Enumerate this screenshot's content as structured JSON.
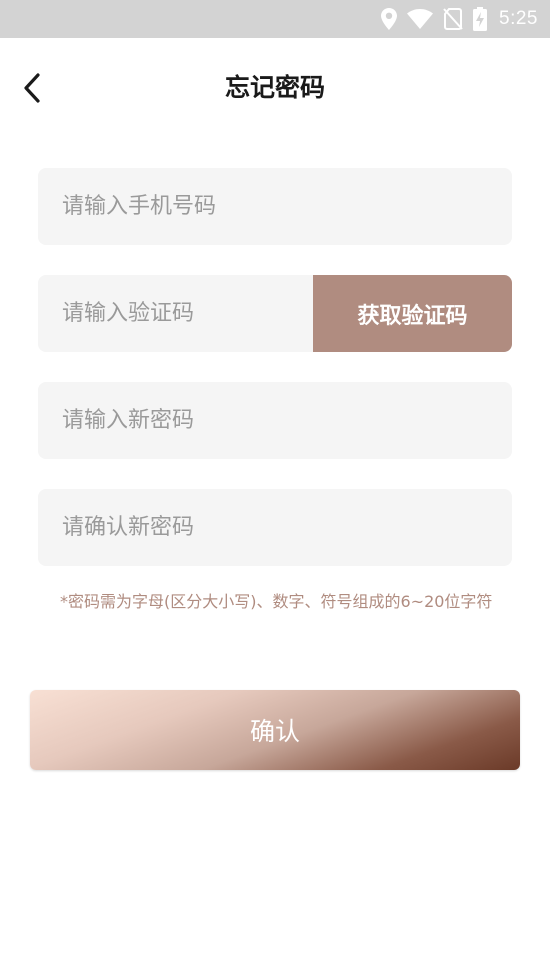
{
  "status_bar": {
    "time": "5:25",
    "icons": [
      "location-icon",
      "wifi-icon",
      "no-sim-icon",
      "battery-charging-icon"
    ]
  },
  "header": {
    "title": "忘记密码",
    "back_icon": "chevron-left-icon"
  },
  "form": {
    "phone_placeholder": "请输入手机号码",
    "code_placeholder": "请输入验证码",
    "get_code_label": "获取验证码",
    "new_password_placeholder": "请输入新密码",
    "confirm_password_placeholder": "请确认新密码",
    "hint": "*密码需为字母(区分大小写)、数字、符号组成的6~20位字符",
    "submit_label": "确认"
  },
  "colors": {
    "accent": "#b08c80",
    "field_bg": "#f5f5f5",
    "status_bar_bg": "#d3d3d3",
    "gradient_start": "#f8e0d4",
    "gradient_end": "#6b3a28"
  }
}
